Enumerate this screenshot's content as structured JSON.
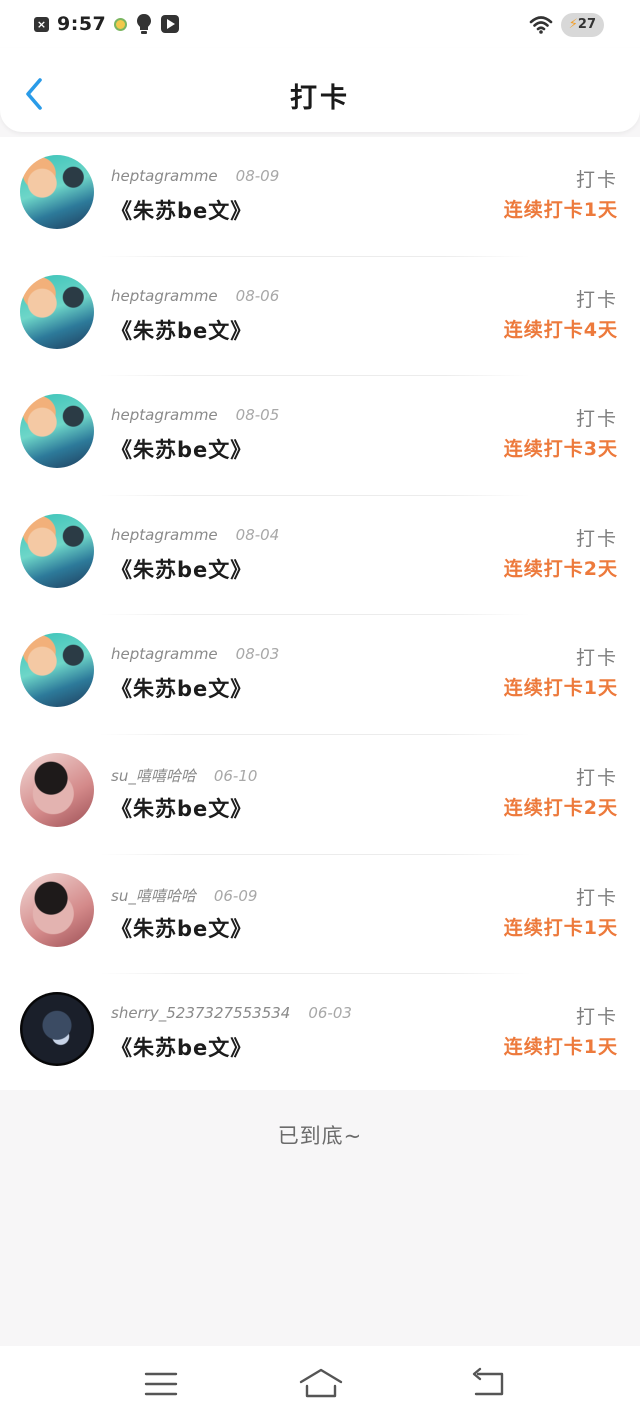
{
  "status_bar": {
    "time": "9:57",
    "battery": "27"
  },
  "header": {
    "title": "打卡"
  },
  "entries": [
    {
      "username": "heptagramme",
      "date": "08-09",
      "book": "《朱苏be文》",
      "action": "打卡",
      "streak": "连续打卡1天",
      "avatar": "t1"
    },
    {
      "username": "heptagramme",
      "date": "08-06",
      "book": "《朱苏be文》",
      "action": "打卡",
      "streak": "连续打卡4天",
      "avatar": "t1"
    },
    {
      "username": "heptagramme",
      "date": "08-05",
      "book": "《朱苏be文》",
      "action": "打卡",
      "streak": "连续打卡3天",
      "avatar": "t1"
    },
    {
      "username": "heptagramme",
      "date": "08-04",
      "book": "《朱苏be文》",
      "action": "打卡",
      "streak": "连续打卡2天",
      "avatar": "t1"
    },
    {
      "username": "heptagramme",
      "date": "08-03",
      "book": "《朱苏be文》",
      "action": "打卡",
      "streak": "连续打卡1天",
      "avatar": "t1"
    },
    {
      "username": "su_嘻嘻哈哈",
      "date": "06-10",
      "book": "《朱苏be文》",
      "action": "打卡",
      "streak": "连续打卡2天",
      "avatar": "t2"
    },
    {
      "username": "su_嘻嘻哈哈",
      "date": "06-09",
      "book": "《朱苏be文》",
      "action": "打卡",
      "streak": "连续打卡1天",
      "avatar": "t2"
    },
    {
      "username": "sherry_5237327553534",
      "date": "06-03",
      "book": "《朱苏be文》",
      "action": "打卡",
      "streak": "连续打卡1天",
      "avatar": "t3"
    }
  ],
  "footer": {
    "end_text": "已到底~"
  },
  "colors": {
    "accent_blue": "#2a9be8",
    "streak_orange": "#ed7a3c"
  },
  "icons": {
    "back": "chevron-left-icon",
    "menu": "menu-icon",
    "home": "home-icon",
    "system_back": "return-icon"
  }
}
